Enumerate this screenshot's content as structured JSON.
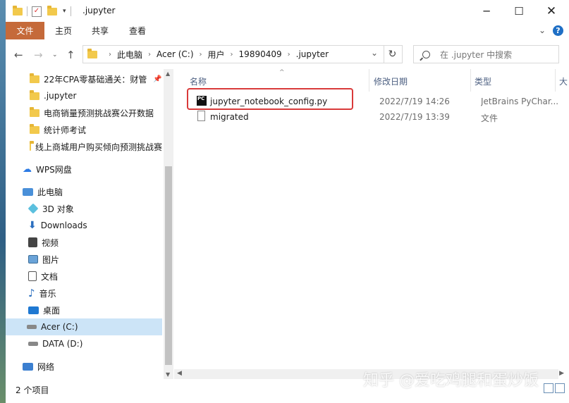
{
  "window": {
    "title": ".jupyter"
  },
  "ribbon": {
    "tabs": [
      "文件",
      "主页",
      "共享",
      "查看"
    ]
  },
  "address": {
    "crumbs": [
      "此电脑",
      "Acer (C:)",
      "用户",
      "19890409",
      ".jupyter"
    ]
  },
  "search": {
    "placeholder": "在 .jupyter 中搜索"
  },
  "nav": {
    "quick_access": [
      {
        "label": "22年CPA零基础通关：财管"
      },
      {
        "label": ".jupyter"
      },
      {
        "label": "电商销量预测挑战赛公开数据"
      },
      {
        "label": "统计师考试"
      },
      {
        "label": "线上商城用户购买倾向预测挑战赛"
      }
    ],
    "wps": "WPS网盘",
    "this_pc": "此电脑",
    "pc_items": [
      {
        "label": "3D 对象",
        "icon": "cube-3d-icon"
      },
      {
        "label": "Downloads",
        "icon": "download-arrow-icon"
      },
      {
        "label": "视频",
        "icon": "video-icon"
      },
      {
        "label": "图片",
        "icon": "picture-icon"
      },
      {
        "label": "文档",
        "icon": "document-icon"
      },
      {
        "label": "音乐",
        "icon": "music-note-icon"
      },
      {
        "label": "桌面",
        "icon": "desktop-icon"
      },
      {
        "label": "Acer (C:)",
        "icon": "drive-c-icon"
      },
      {
        "label": "DATA (D:)",
        "icon": "drive-d-icon"
      }
    ],
    "network": "网络"
  },
  "columns": {
    "name": "名称",
    "date": "修改日期",
    "type": "类型",
    "size": "大"
  },
  "files": [
    {
      "name": "jupyter_notebook_config.py",
      "date": "2022/7/19 14:26",
      "type": "JetBrains PyChar..."
    },
    {
      "name": "migrated",
      "date": "2022/7/19 13:39",
      "type": "文件"
    }
  ],
  "status": {
    "count": "2 个项目"
  },
  "watermark": "知乎 @爱吃鸡腿和蛋炒饭",
  "colors": {
    "file_tab": "#c56a3a",
    "selection": "#cce4f7",
    "highlight_box": "#d93a3a",
    "folder": "#f2c94c"
  }
}
